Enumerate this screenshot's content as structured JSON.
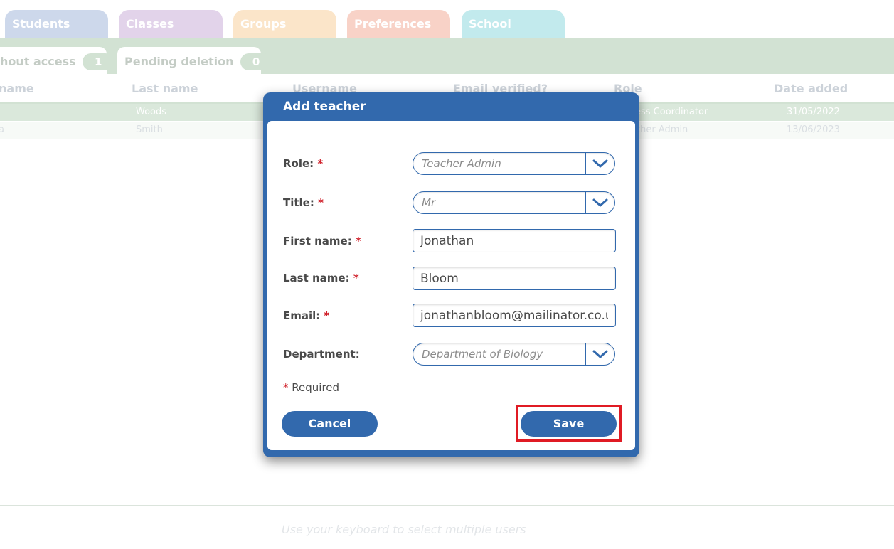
{
  "top_tabs": {
    "students": "Students",
    "classes": "Classes",
    "groups": "Groups",
    "preferences": "Preferences",
    "school": "School"
  },
  "sub_tabs": {
    "without_access": {
      "label": "hout access",
      "count": "1"
    },
    "pending_deletion": {
      "label": "Pending deletion",
      "count": "0"
    }
  },
  "table": {
    "headers": {
      "first_name": "name",
      "last_name": "Last name",
      "username": "Username",
      "email_verified": "Email verified?",
      "role": "Role",
      "date_added": "Date added"
    },
    "rows": [
      {
        "first_name": "",
        "last_name": "Woods",
        "role": "ess Coordinator",
        "date_added": "31/05/2022"
      },
      {
        "first_name": "a",
        "last_name": "Smith",
        "role": "cher Admin",
        "date_added": "13/06/2023"
      }
    ]
  },
  "footer": {
    "hint": "Use your keyboard to select multiple users"
  },
  "modal": {
    "title": "Add teacher",
    "required_marker": "*",
    "fields": {
      "role": {
        "label": "Role:",
        "value": "Teacher Admin"
      },
      "title": {
        "label": "Title:",
        "value": "Mr"
      },
      "first_name": {
        "label": "First name:",
        "value": "Jonathan"
      },
      "last_name": {
        "label": "Last name:",
        "value": "Bloom"
      },
      "email": {
        "label": "Email:",
        "value": "jonathanbloom@mailinator.co.uk"
      },
      "department": {
        "label": "Department:",
        "value": "Department of Biology"
      }
    },
    "required_note": "Required",
    "cancel_label": "Cancel",
    "save_label": "Save"
  },
  "colors": {
    "modal_blue": "#3269ad",
    "required_red": "#d0202a",
    "highlight_red": "#e01b24"
  },
  "icons": {
    "dropdown": "chevron-down-icon"
  }
}
